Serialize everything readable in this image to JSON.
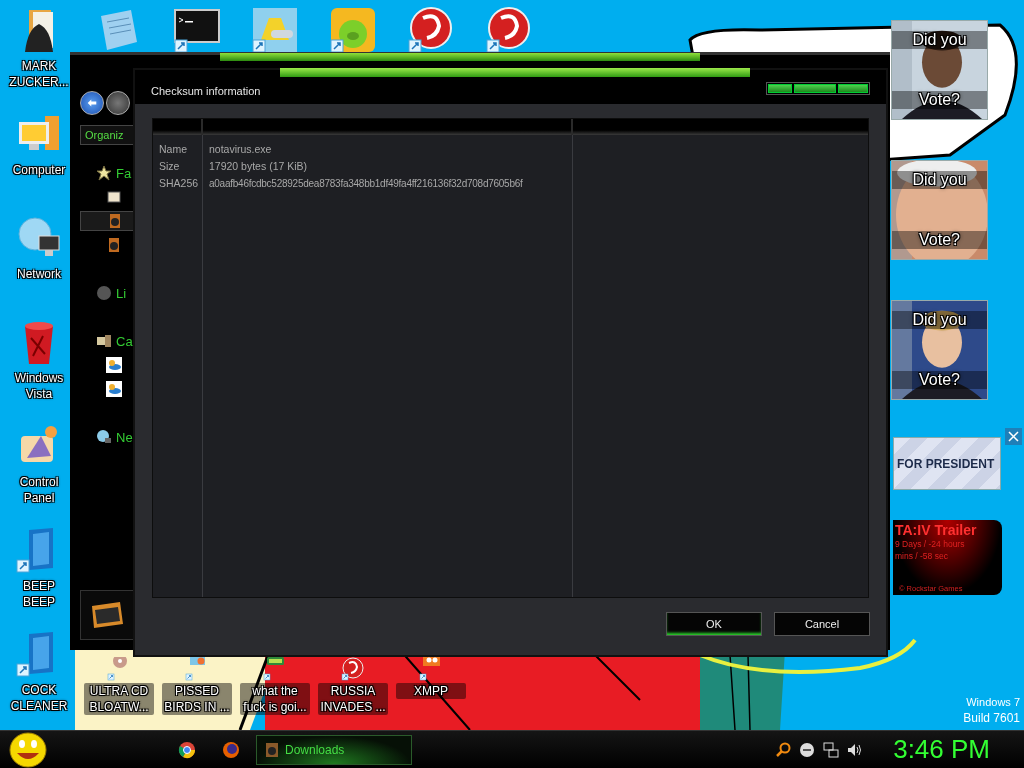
{
  "desktop_icons": [
    {
      "label": "MARK ZUCKER...",
      "kind": "book"
    },
    {
      "label": "Computer",
      "kind": "computer"
    },
    {
      "label": "Network",
      "kind": "globe"
    },
    {
      "label": "Windows Vista",
      "kind": "trash"
    },
    {
      "label": "Control Panel",
      "kind": "palette"
    },
    {
      "label": "BEEP BEEP",
      "kind": "box"
    },
    {
      "label": "COCK CLEANER",
      "kind": "box"
    }
  ],
  "top_icons": [
    {
      "kind": "notes"
    },
    {
      "kind": "terminal"
    },
    {
      "kind": "folder"
    },
    {
      "kind": "pig"
    },
    {
      "kind": "ball"
    },
    {
      "kind": "ball"
    }
  ],
  "bottom_icons": [
    {
      "label": "ULTRA CD BLOATW...",
      "kind": "disc"
    },
    {
      "label": "PISSED BIRDS IN ...",
      "kind": "bird"
    },
    {
      "label": "what the fuck is goi...",
      "kind": "game"
    },
    {
      "label": "RUSSIA INVADES ...",
      "kind": "ball"
    },
    {
      "label": "XMPP",
      "kind": "tile"
    }
  ],
  "explorer": {
    "organize": "Organiz",
    "nav": [
      {
        "label": "Fa",
        "kind": "star",
        "selected": false,
        "children": [
          {
            "kind": "book",
            "selected": false
          },
          {
            "kind": "media",
            "selected": true
          },
          {
            "kind": "media",
            "selected": false
          }
        ]
      },
      {
        "label": "Li",
        "kind": "circle",
        "selected": false
      },
      {
        "label": "Ca",
        "kind": "computer",
        "selected": false,
        "children": [
          {
            "kind": "drive",
            "selected": false
          },
          {
            "kind": "drive",
            "selected": false
          }
        ]
      },
      {
        "label": "Ne",
        "kind": "globe",
        "selected": false
      }
    ]
  },
  "dialog": {
    "title": "Checksum information",
    "rows": [
      {
        "field": "Name",
        "value": "notavirus.exe"
      },
      {
        "field": "Size",
        "value": "17920 bytes (17 KiB)"
      },
      {
        "field": "SHA256",
        "value": "a0aafb46fcdbc528925dea8783fa348bb1df49fa4ff216136f32d708d7605b6f"
      }
    ],
    "buttons": [
      {
        "label": "OK",
        "selected": true
      },
      {
        "label": "Cancel",
        "selected": false
      }
    ]
  },
  "vote_gadgets": [
    {
      "top": "Did you",
      "bottom": "Vote?",
      "kind": "suit"
    },
    {
      "top": "Did you",
      "bottom": "Vote?",
      "kind": "closeup"
    },
    {
      "top": "Did you",
      "bottom": "Vote?",
      "kind": "blue"
    }
  ],
  "president_gadget": {
    "text": "FOR PRESIDENT"
  },
  "gta_gadget": {
    "title": "TA:IV Trailer",
    "line_1": "9 Days / -24 hours",
    "line_2": "mins / -58 sec",
    "credit": "© Rockstar Games"
  },
  "watermark_text": [
    "Windows 7",
    "Build 7601"
  ],
  "taskbar": {
    "tasks": [
      {
        "label": "Downloads",
        "selected": true
      }
    ],
    "clock": "3:46 PM"
  }
}
